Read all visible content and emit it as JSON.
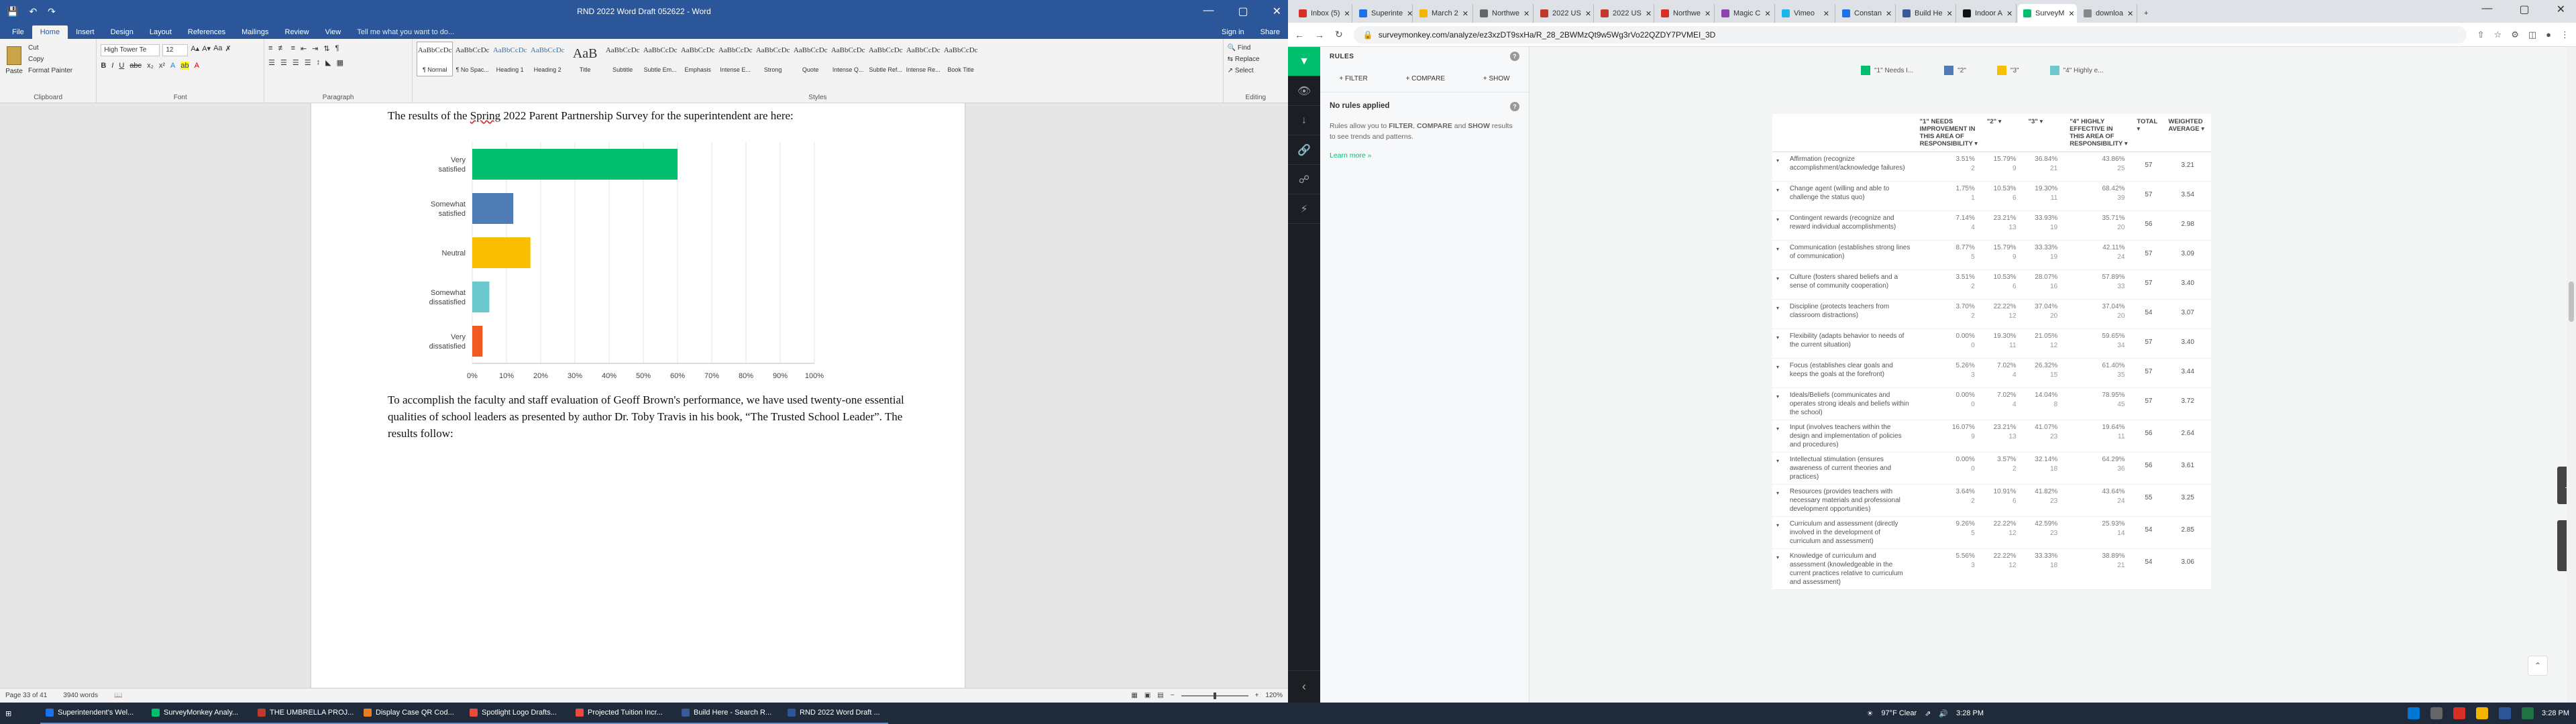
{
  "word": {
    "title": "RND 2022 Word Draft 052622 - Word",
    "tabs": [
      "File",
      "Home",
      "Insert",
      "Design",
      "Layout",
      "References",
      "Mailings",
      "Review",
      "View"
    ],
    "tell_me": "Tell me what you want to do...",
    "sign_in": "Sign in",
    "share": "Share",
    "clipboard": {
      "paste": "Paste",
      "cut": "Cut",
      "copy": "Copy",
      "format_painter": "Format Painter",
      "label": "Clipboard"
    },
    "font": {
      "name": "High Tower Te",
      "size": "12",
      "label": "Font"
    },
    "paragraph_label": "Paragraph",
    "styles_label": "Styles",
    "editing": {
      "find": "Find",
      "replace": "Replace",
      "select": "Select",
      "label": "Editing"
    },
    "styles": [
      {
        "preview": "AaBbCcDc",
        "name": "¶ Normal"
      },
      {
        "preview": "AaBbCcDc",
        "name": "¶ No Spac..."
      },
      {
        "preview": "AaBbCcDc",
        "name": "Heading 1"
      },
      {
        "preview": "AaBbCcDc",
        "name": "Heading 2"
      },
      {
        "preview": "AaB",
        "name": "Title"
      },
      {
        "preview": "AaBbCcDc",
        "name": "Subtitle"
      },
      {
        "preview": "AaBbCcDc",
        "name": "Subtle Em..."
      },
      {
        "preview": "AaBbCcDc",
        "name": "Emphasis"
      },
      {
        "preview": "AaBbCcDc",
        "name": "Intense E..."
      },
      {
        "preview": "AaBbCcDc",
        "name": "Strong"
      },
      {
        "preview": "AaBbCcDc",
        "name": "Quote"
      },
      {
        "preview": "AaBbCcDc",
        "name": "Intense Q..."
      },
      {
        "preview": "AaBbCcDc",
        "name": "Subtle Ref..."
      },
      {
        "preview": "AaBbCcDc",
        "name": "Intense Re..."
      },
      {
        "preview": "AaBbCcDc",
        "name": "Book Title"
      }
    ],
    "para1_a": "The results of the ",
    "para1_spring": "Spring",
    "para1_b": " 2022 Parent Partnership Survey for the superintendent are here:",
    "para2": "To accomplish the faculty and staff evaluation of Geoff Brown's performance, we have used twenty-one essential qualities of school leaders as presented by author Dr. Toby Travis in his book, “The Trusted School Leader”.  The results follow:",
    "status": {
      "page": "Page 33 of 41",
      "words": "3940 words",
      "zoom": "120%"
    }
  },
  "chart_data": {
    "type": "bar",
    "orientation": "horizontal",
    "categories": [
      "Very satisfied",
      "Somewhat satisfied",
      "Neutral",
      "Somewhat dissatisfied",
      "Very dissatisfied"
    ],
    "values": [
      60,
      12,
      17,
      5,
      3
    ],
    "colors": [
      "#00bf6f",
      "#507cb6",
      "#f9be00",
      "#6bc8cd",
      "#f05b24"
    ],
    "xlim": [
      0,
      100
    ],
    "xticks": [
      "0%",
      "10%",
      "20%",
      "30%",
      "40%",
      "50%",
      "60%",
      "70%",
      "80%",
      "90%",
      "100%"
    ],
    "grid": true
  },
  "browser": {
    "tabs": [
      {
        "label": "Inbox (5)",
        "color": "#d93025"
      },
      {
        "label": "Superinte",
        "color": "#1a73e8"
      },
      {
        "label": "March 2",
        "color": "#f4b400"
      },
      {
        "label": "Northwe",
        "color": "#666"
      },
      {
        "label": "2022 US",
        "color": "#c0392b"
      },
      {
        "label": "2022 US",
        "color": "#c0392b"
      },
      {
        "label": "Northwe",
        "color": "#d93025"
      },
      {
        "label": "Magic C",
        "color": "#8e44ad"
      },
      {
        "label": "Vimeo",
        "color": "#1ab7ea"
      },
      {
        "label": "Constan",
        "color": "#1a73e8"
      },
      {
        "label": "Build He",
        "color": "#3b5998"
      },
      {
        "label": "Indoor A",
        "color": "#111"
      },
      {
        "label": "SurveyM",
        "color": "#00bf6f"
      },
      {
        "label": "downloa",
        "color": "#888"
      }
    ],
    "url": "surveymonkey.com/analyze/ez3xzDT9sxHa/R_28_2BWMzQt9w5Wg3rVo22QZDY7PVMEI_3D"
  },
  "sidebar": {
    "title": "RULES",
    "actions": [
      "+ FILTER",
      "+ COMPARE",
      "+ SHOW"
    ],
    "no_rules": "No rules applied",
    "desc_a": "Rules allow you to ",
    "desc_f": "FILTER",
    "desc_sep": ", ",
    "desc_c": "COMPARE",
    "desc_and": " and ",
    "desc_s": "SHOW",
    "desc_b": " results to see trends and patterns.",
    "learn": "Learn more »"
  },
  "legend": [
    {
      "label": "\"1\" Needs I...",
      "color": "#00bf6f"
    },
    {
      "label": "\"2\"",
      "color": "#507cb6"
    },
    {
      "label": "\"3\"",
      "color": "#f9be00"
    },
    {
      "label": "\"4\" Highly e...",
      "color": "#6bc8cd"
    }
  ],
  "table": {
    "headers": [
      "\"1\" NEEDS IMPROVEMENT IN THIS AREA OF RESPONSIBILITY",
      "\"2\"",
      "\"3\"",
      "\"4\" HIGHLY EFFECTIVE IN THIS AREA OF RESPONSIBILITY",
      "TOTAL",
      "WEIGHTED AVERAGE"
    ],
    "rows": [
      {
        "q": "Affirmation (recognize accomplishment/acknowledge failures)",
        "c": [
          [
            "3.51%",
            "2"
          ],
          [
            "15.79%",
            "9"
          ],
          [
            "36.84%",
            "21"
          ],
          [
            "43.86%",
            "25"
          ]
        ],
        "total": "57",
        "avg": "3.21"
      },
      {
        "q": "Change agent (willing and able to challenge the status quo)",
        "c": [
          [
            "1.75%",
            "1"
          ],
          [
            "10.53%",
            "6"
          ],
          [
            "19.30%",
            "11"
          ],
          [
            "68.42%",
            "39"
          ]
        ],
        "total": "57",
        "avg": "3.54"
      },
      {
        "q": "Contingent rewards (recognize and reward individual accomplishments)",
        "c": [
          [
            "7.14%",
            "4"
          ],
          [
            "23.21%",
            "13"
          ],
          [
            "33.93%",
            "19"
          ],
          [
            "35.71%",
            "20"
          ]
        ],
        "total": "56",
        "avg": "2.98"
      },
      {
        "q": "Communication (establishes strong lines of communication)",
        "c": [
          [
            "8.77%",
            "5"
          ],
          [
            "15.79%",
            "9"
          ],
          [
            "33.33%",
            "19"
          ],
          [
            "42.11%",
            "24"
          ]
        ],
        "total": "57",
        "avg": "3.09"
      },
      {
        "q": "Culture (fosters shared beliefs and a sense of community cooperation)",
        "c": [
          [
            "3.51%",
            "2"
          ],
          [
            "10.53%",
            "6"
          ],
          [
            "28.07%",
            "16"
          ],
          [
            "57.89%",
            "33"
          ]
        ],
        "total": "57",
        "avg": "3.40"
      },
      {
        "q": "Discipline (protects teachers from classroom distractions)",
        "c": [
          [
            "3.70%",
            "2"
          ],
          [
            "22.22%",
            "12"
          ],
          [
            "37.04%",
            "20"
          ],
          [
            "37.04%",
            "20"
          ]
        ],
        "total": "54",
        "avg": "3.07"
      },
      {
        "q": "Flexibility (adapts behavior to needs of the current situation)",
        "c": [
          [
            "0.00%",
            "0"
          ],
          [
            "19.30%",
            "11"
          ],
          [
            "21.05%",
            "12"
          ],
          [
            "59.65%",
            "34"
          ]
        ],
        "total": "57",
        "avg": "3.40"
      },
      {
        "q": "Focus (establishes clear goals and keeps the goals at the forefront)",
        "c": [
          [
            "5.26%",
            "3"
          ],
          [
            "7.02%",
            "4"
          ],
          [
            "26.32%",
            "15"
          ],
          [
            "61.40%",
            "35"
          ]
        ],
        "total": "57",
        "avg": "3.44"
      },
      {
        "q": "Ideals/Beliefs (communicates and operates strong ideals and beliefs within the school)",
        "c": [
          [
            "0.00%",
            "0"
          ],
          [
            "7.02%",
            "4"
          ],
          [
            "14.04%",
            "8"
          ],
          [
            "78.95%",
            "45"
          ]
        ],
        "total": "57",
        "avg": "3.72"
      },
      {
        "q": "Input (involves teachers within the design and implementation of policies and procedures)",
        "c": [
          [
            "16.07%",
            "9"
          ],
          [
            "23.21%",
            "13"
          ],
          [
            "41.07%",
            "23"
          ],
          [
            "19.64%",
            "11"
          ]
        ],
        "total": "56",
        "avg": "2.64"
      },
      {
        "q": "Intellectual stimulation (ensures awareness of current theories and practices)",
        "c": [
          [
            "0.00%",
            "0"
          ],
          [
            "3.57%",
            "2"
          ],
          [
            "32.14%",
            "18"
          ],
          [
            "64.29%",
            "36"
          ]
        ],
        "total": "56",
        "avg": "3.61"
      },
      {
        "q": "Resources (provides teachers with necessary materials and professional development opportunities)",
        "c": [
          [
            "3.64%",
            "2"
          ],
          [
            "10.91%",
            "6"
          ],
          [
            "41.82%",
            "23"
          ],
          [
            "43.64%",
            "24"
          ]
        ],
        "total": "55",
        "avg": "3.25"
      },
      {
        "q": "Curriculum and assessment (directly involved in the development of curriculum and assessment)",
        "c": [
          [
            "9.26%",
            "5"
          ],
          [
            "22.22%",
            "12"
          ],
          [
            "42.59%",
            "23"
          ],
          [
            "25.93%",
            "14"
          ]
        ],
        "total": "54",
        "avg": "2.85"
      },
      {
        "q": "Knowledge of curriculum and assessment (knowledgeable in the current practices relative to curriculum and assessment)",
        "c": [
          [
            "5.56%",
            "3"
          ],
          [
            "22.22%",
            "12"
          ],
          [
            "33.33%",
            "18"
          ],
          [
            "38.89%",
            "21"
          ]
        ],
        "total": "54",
        "avg": "3.06"
      }
    ]
  },
  "side_buttons": {
    "help": "Help!",
    "feedback": "Feedback"
  },
  "taskbar": {
    "items": [
      {
        "label": "Superintendent's Wel...",
        "color": "#1a73e8"
      },
      {
        "label": "SurveyMonkey Analy...",
        "color": "#00bf6f"
      },
      {
        "label": "THE UMBRELLA PROJ...",
        "color": "#c0392b"
      },
      {
        "label": "Display Case QR Cod...",
        "color": "#e67e22"
      },
      {
        "label": "Spotlight Logo Drafts...",
        "color": "#e74c3c"
      },
      {
        "label": "Projected Tuition Incr...",
        "color": "#e74c3c"
      },
      {
        "label": "Build Here - Search R...",
        "color": "#3b5998"
      },
      {
        "label": "RND 2022 Word Draft ...",
        "color": "#2b579a"
      }
    ],
    "weather": "97°F  Clear",
    "time": "3:28 PM",
    "time_r": "3:28 PM"
  }
}
